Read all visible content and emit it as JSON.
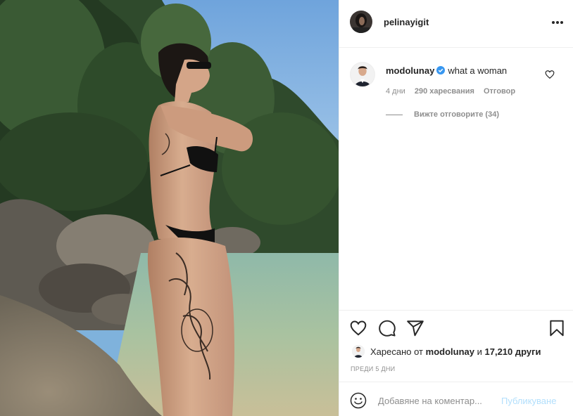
{
  "post": {
    "author": "pelinayigit",
    "photo_alt": "Woman in black bikini with tattoos standing on a rocky beach",
    "comment": {
      "username": "modolunay",
      "verified": true,
      "text": "what a woman",
      "time": "4 дни",
      "likes": "290 харесвания",
      "reply_label": "Отговор",
      "view_replies": "Вижте отговорите (34)"
    },
    "liked_by": {
      "prefix": "Харесано от",
      "user": "modolunay",
      "joiner": "и",
      "others": "17,210 други"
    },
    "posted_ago": "ПРЕДИ 5 ДНИ",
    "add_comment_placeholder": "Добавяне на коментар...",
    "publish_label": "Публикуване"
  },
  "colors": {
    "text": "#262626",
    "muted": "#8e8e8e",
    "border": "#efefef",
    "verified": "#3897f0",
    "publish_disabled": "#b2dffc"
  },
  "icons": [
    "more-icon",
    "verified-icon",
    "heart-icon",
    "comment-icon",
    "share-icon",
    "save-icon",
    "emoji-icon"
  ]
}
